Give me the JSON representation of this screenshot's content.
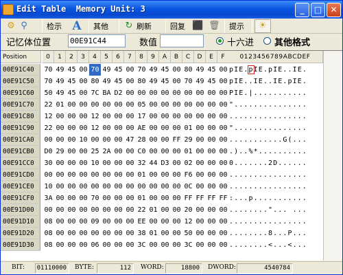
{
  "window": {
    "title": "Edit Table  Memory Unit: 3",
    "min": "_",
    "max": "□",
    "close": "✕"
  },
  "toolbar": {
    "search": "检示",
    "other": "其他",
    "refresh": "刷新",
    "restore": "回复",
    "hint": "提示"
  },
  "info": {
    "addr_label": "记忆体位置",
    "addr_value": "00E91C44",
    "value_label": "数值",
    "value_value": "",
    "hex_label": "十六进",
    "other_label": "其他格式"
  },
  "grid": {
    "position_header": "Position",
    "hex_headers": [
      "0",
      "1",
      "2",
      "3",
      "4",
      "5",
      "6",
      "7",
      "8",
      "9",
      "A",
      "B",
      "C",
      "D",
      "E",
      "F"
    ],
    "ascii_header": "0123456789ABCDEF",
    "rows": [
      {
        "addr": "00E91C40",
        "bytes": [
          "70",
          "49",
          "45",
          "00",
          "70",
          "49",
          "45",
          "00",
          "70",
          "49",
          "45",
          "00",
          "80",
          "49",
          "45",
          "00"
        ],
        "ascii": "pIE.pIE.pIE..IE."
      },
      {
        "addr": "00E91C50",
        "bytes": [
          "70",
          "49",
          "45",
          "00",
          "80",
          "49",
          "45",
          "00",
          "80",
          "49",
          "45",
          "00",
          "70",
          "49",
          "45",
          "00"
        ],
        "ascii": "pIE..IE..IE.pIE."
      },
      {
        "addr": "00E91C60",
        "bytes": [
          "50",
          "49",
          "45",
          "00",
          "7C",
          "BA",
          "D2",
          "00",
          "00",
          "00",
          "00",
          "00",
          "00",
          "00",
          "00",
          "00"
        ],
        "ascii": "PIE.|..........."
      },
      {
        "addr": "00E91C70",
        "bytes": [
          "22",
          "01",
          "00",
          "00",
          "00",
          "00",
          "00",
          "00",
          "05",
          "00",
          "00",
          "00",
          "00",
          "00",
          "00",
          "00"
        ],
        "ascii": "\"..............."
      },
      {
        "addr": "00E91C80",
        "bytes": [
          "12",
          "00",
          "00",
          "00",
          "12",
          "00",
          "00",
          "00",
          "17",
          "00",
          "00",
          "00",
          "00",
          "00",
          "00",
          "00"
        ],
        "ascii": "................"
      },
      {
        "addr": "00E91C90",
        "bytes": [
          "22",
          "00",
          "00",
          "00",
          "12",
          "00",
          "00",
          "00",
          "AE",
          "00",
          "00",
          "00",
          "01",
          "00",
          "00",
          "00"
        ],
        "ascii": "\"..............."
      },
      {
        "addr": "00E91CA0",
        "bytes": [
          "00",
          "00",
          "00",
          "10",
          "00",
          "00",
          "00",
          "47",
          "28",
          "00",
          "00",
          "FF",
          "29",
          "00",
          "00",
          "00"
        ],
        "ascii": "...........G(..."
      },
      {
        "addr": "00E91CB0",
        "bytes": [
          "D0",
          "29",
          "00",
          "00",
          "25",
          "2A",
          "00",
          "00",
          "C0",
          "00",
          "00",
          "00",
          "01",
          "00",
          "00",
          "00"
        ],
        "ascii": ".)..%*.........."
      },
      {
        "addr": "00E91CC0",
        "bytes": [
          "30",
          "00",
          "00",
          "00",
          "10",
          "00",
          "00",
          "00",
          "32",
          "44",
          "D3",
          "00",
          "02",
          "00",
          "00",
          "00"
        ],
        "ascii": "0.......2D......"
      },
      {
        "addr": "00E91CD0",
        "bytes": [
          "00",
          "00",
          "00",
          "00",
          "00",
          "00",
          "00",
          "00",
          "01",
          "00",
          "00",
          "00",
          "F6",
          "00",
          "00",
          "00"
        ],
        "ascii": "................"
      },
      {
        "addr": "00E91CE0",
        "bytes": [
          "10",
          "00",
          "00",
          "00",
          "00",
          "00",
          "00",
          "00",
          "00",
          "00",
          "00",
          "00",
          "0C",
          "00",
          "00",
          "00"
        ],
        "ascii": "................"
      },
      {
        "addr": "00E91CF0",
        "bytes": [
          "3A",
          "00",
          "00",
          "00",
          "70",
          "00",
          "00",
          "00",
          "01",
          "00",
          "00",
          "00",
          "FF",
          "FF",
          "FF",
          "FF"
        ],
        "ascii": ":...p..........."
      },
      {
        "addr": "00E91D00",
        "bytes": [
          "00",
          "00",
          "00",
          "00",
          "00",
          "00",
          "00",
          "00",
          "22",
          "01",
          "00",
          "00",
          "20",
          "00",
          "00",
          "00"
        ],
        "ascii": "........\"... ..."
      },
      {
        "addr": "00E91D10",
        "bytes": [
          "08",
          "00",
          "00",
          "00",
          "09",
          "00",
          "00",
          "00",
          "EE",
          "00",
          "00",
          "00",
          "12",
          "00",
          "00",
          "00"
        ],
        "ascii": "................"
      },
      {
        "addr": "00E91D20",
        "bytes": [
          "08",
          "00",
          "00",
          "00",
          "00",
          "00",
          "00",
          "00",
          "38",
          "01",
          "00",
          "00",
          "50",
          "00",
          "00",
          "00"
        ],
        "ascii": "........8...P..."
      },
      {
        "addr": "00E91D30",
        "bytes": [
          "08",
          "00",
          "00",
          "00",
          "06",
          "00",
          "00",
          "00",
          "3C",
          "00",
          "00",
          "00",
          "3C",
          "00",
          "00",
          "00"
        ],
        "ascii": "........<...<..."
      }
    ],
    "selected": {
      "row": 0,
      "col": 4
    }
  },
  "status": {
    "bit_label": "BIT:",
    "bit_value": "01110000",
    "byte_label": "BYTE:",
    "byte_value": "112",
    "word_label": "WORD:",
    "word_value": "18800",
    "dword_label": "DWORD:",
    "dword_value": "4540784"
  },
  "colors": {
    "title_gradient": "#0a56e0",
    "selection": "#316ac5",
    "cursor_box": "#e02020"
  },
  "icons": {
    "toolbar": [
      "magnify-icon",
      "gears-icon",
      "font-a-icon",
      "refresh-icon",
      "restore-icon",
      "trash-icon",
      "settings-icon"
    ]
  }
}
